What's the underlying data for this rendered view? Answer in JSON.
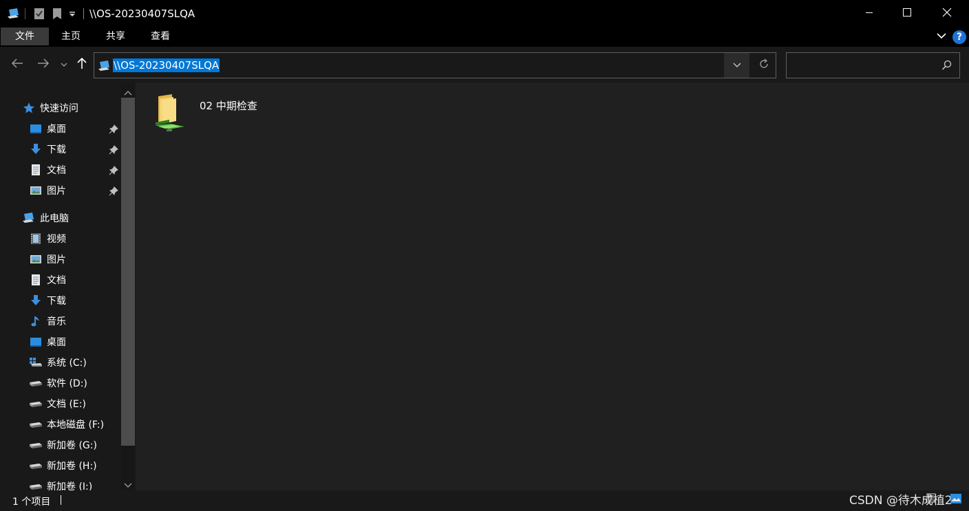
{
  "window": {
    "title": "\\\\OS-20230407SLQA",
    "minimize_icon": "minimize-icon",
    "maximize_icon": "maximize-icon",
    "close_icon": "close-icon"
  },
  "ribbon": {
    "tabs": [
      "文件",
      "主页",
      "共享",
      "查看"
    ],
    "active_tab_color": "#3a3a3a"
  },
  "address": {
    "path": "\\\\OS-20230407SLQA",
    "highlight_color": "#0078d7",
    "search_placeholder": ""
  },
  "sidebar": {
    "quick_access": {
      "label": "快速访问",
      "items": [
        {
          "label": "桌面",
          "icon": "desktop-icon",
          "pinned": true
        },
        {
          "label": "下载",
          "icon": "download-icon",
          "pinned": true
        },
        {
          "label": "文档",
          "icon": "document-icon",
          "pinned": true
        },
        {
          "label": "图片",
          "icon": "picture-icon",
          "pinned": true
        }
      ]
    },
    "this_pc": {
      "label": "此电脑",
      "items": [
        {
          "label": "视频",
          "icon": "video-icon"
        },
        {
          "label": "图片",
          "icon": "picture-icon"
        },
        {
          "label": "文档",
          "icon": "document-icon"
        },
        {
          "label": "下载",
          "icon": "download-icon"
        },
        {
          "label": "音乐",
          "icon": "music-icon"
        },
        {
          "label": "桌面",
          "icon": "desktop-icon"
        },
        {
          "label": "系统 (C:)",
          "icon": "system-drive-icon"
        },
        {
          "label": "软件 (D:)",
          "icon": "drive-icon"
        },
        {
          "label": "文档 (E:)",
          "icon": "drive-icon"
        },
        {
          "label": "本地磁盘 (F:)",
          "icon": "drive-icon"
        },
        {
          "label": "新加卷 (G:)",
          "icon": "drive-icon"
        },
        {
          "label": "新加卷 (H:)",
          "icon": "drive-icon"
        },
        {
          "label": "新加卷 (I:)",
          "icon": "drive-icon"
        }
      ]
    }
  },
  "content": {
    "items": [
      {
        "label": "02 中期检查",
        "icon": "shared-folder-icon"
      }
    ]
  },
  "status": {
    "count_text": "1 个项目"
  },
  "watermark": "CSDN @待木成植2"
}
